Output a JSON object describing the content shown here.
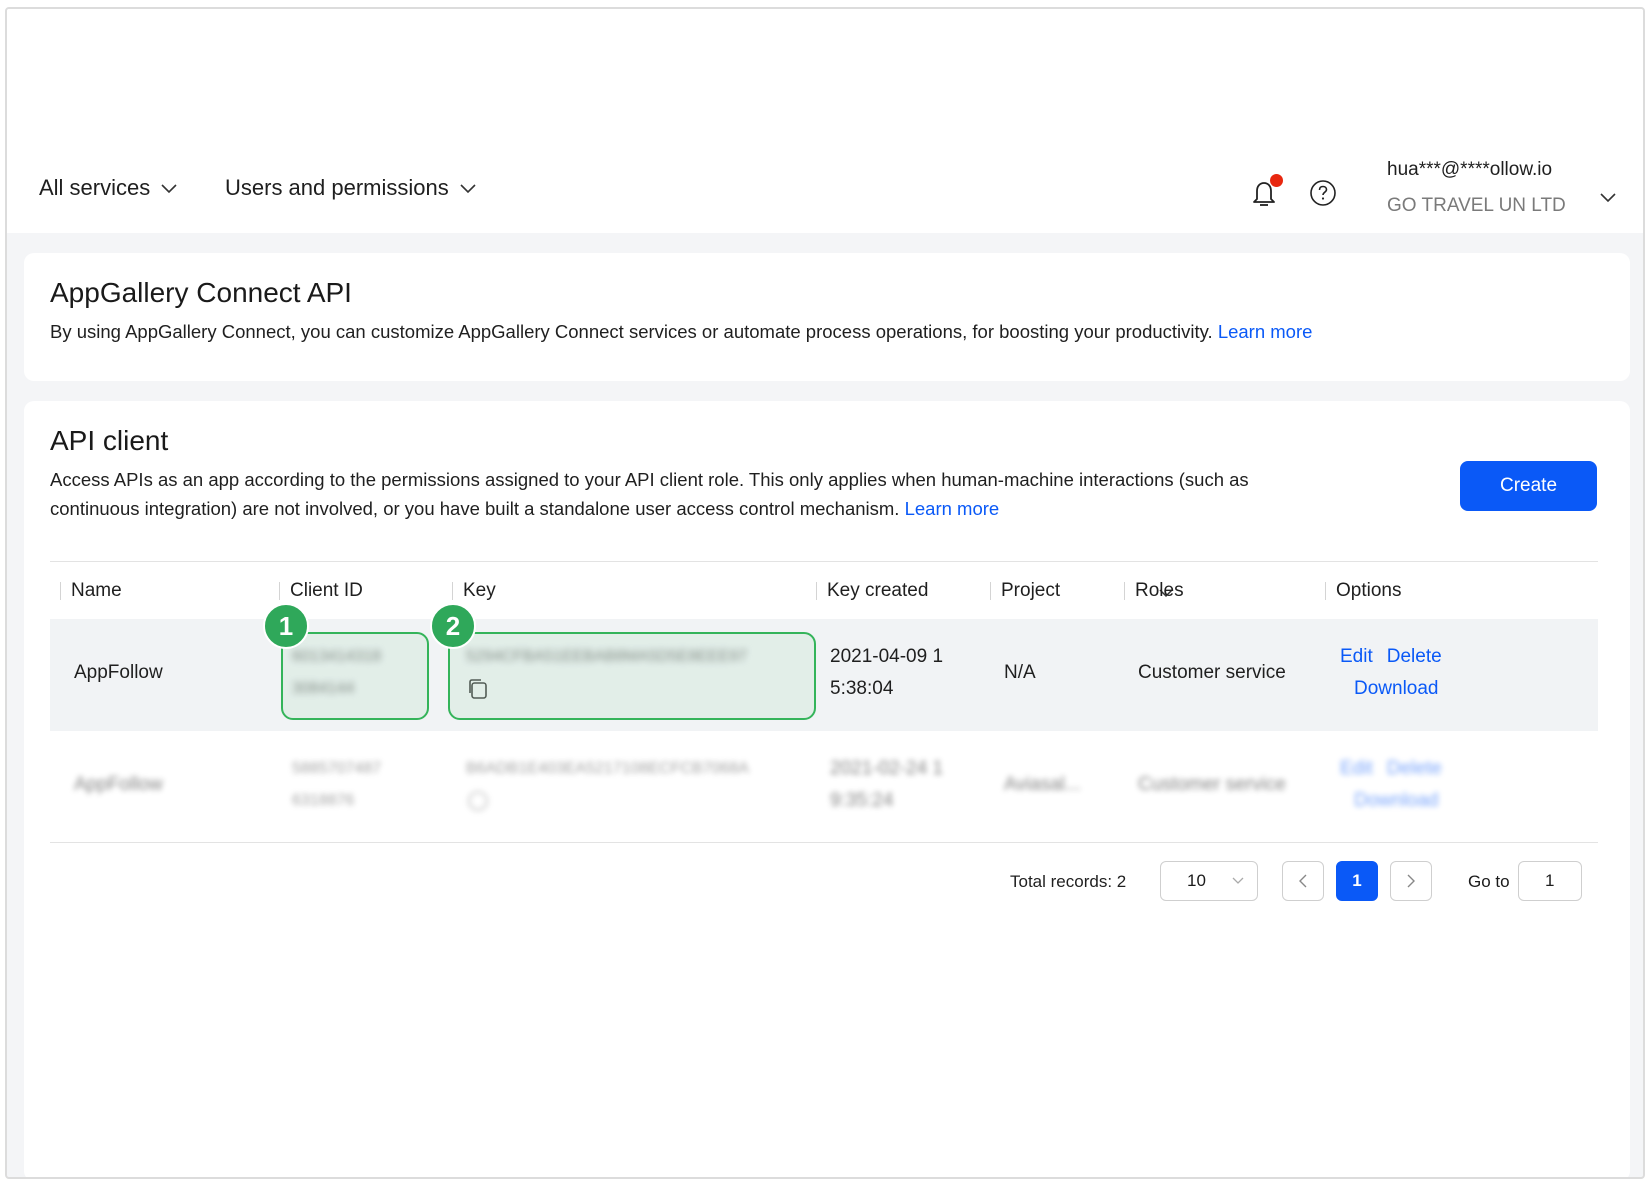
{
  "nav": {
    "all_services": "All services",
    "users_permissions": "Users and permissions"
  },
  "user": {
    "email": "hua***@****ollow.io",
    "org": "GO TRAVEL UN LTD"
  },
  "intro": {
    "title": "AppGallery Connect API",
    "desc": "By using AppGallery Connect, you can customize AppGallery Connect services or automate process operations, for boosting your productivity.",
    "learn_more": "Learn more"
  },
  "api_client": {
    "title": "API client",
    "desc": "Access APIs as an app according to the permissions assigned to your API client role. This only applies when human-machine interactions (such as continuous integration) are not involved, or you have built a standalone user access control mechanism.",
    "learn_more": "Learn more",
    "create": "Create"
  },
  "table": {
    "headers": {
      "name": "Name",
      "client_id": "Client ID",
      "key": "Key",
      "key_created": "Key created",
      "project": "Project",
      "roles": "Roles",
      "options": "Options"
    },
    "rows": [
      {
        "name": "AppFollow",
        "client_id_1": "6013414318",
        "client_id_2": "3084144",
        "key": "5294CFBA51EEBAB8MA5D5E8EEE97",
        "created_1": "2021-04-09 1",
        "created_2": "5:38:04",
        "project": "N/A",
        "role": "Customer service",
        "edit": "Edit",
        "delete": "Delete",
        "download": "Download"
      },
      {
        "name": "AppFollow",
        "client_id_1": "5885707487",
        "client_id_2": "6318876",
        "key": "B6ADB1E403EA5217108ECFCB7068A",
        "created_1": "2021-02-24 1",
        "created_2": "9:35:24",
        "project": "Aviasal...",
        "role": "Customer service",
        "edit": "Edit",
        "delete": "Delete",
        "download": "Download"
      }
    ]
  },
  "annotations": [
    "1",
    "2"
  ],
  "pagination": {
    "total": "Total records: 2",
    "page_size": "10",
    "current_page": "1",
    "goto_label": "Go to",
    "goto_value": "1"
  },
  "colors": {
    "accent": "#0a59f7",
    "notification_dot": "#e8270f",
    "highlight": "#34b45a"
  }
}
